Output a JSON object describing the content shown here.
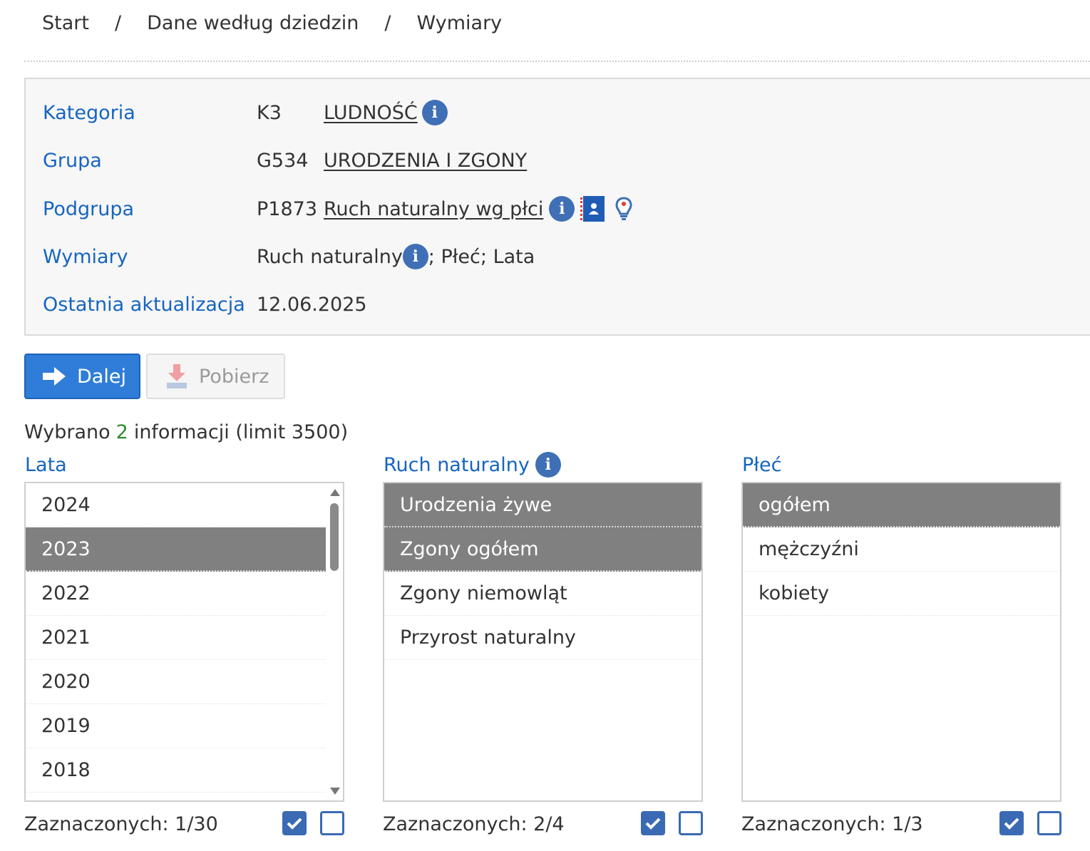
{
  "breadcrumb": {
    "items": [
      "Start",
      "Dane według dziedzin",
      "Wymiary"
    ],
    "separator": "/"
  },
  "info": {
    "kategoria": {
      "label": "Kategoria",
      "code": "K3",
      "value": "LUDNOŚĆ"
    },
    "grupa": {
      "label": "Grupa",
      "code": "G534",
      "value": "URODZENIA I ZGONY"
    },
    "podgrupa": {
      "label": "Podgrupa",
      "code": "P1873",
      "value": "Ruch naturalny wg płci"
    },
    "wymiary": {
      "label": "Wymiary",
      "value_first": "Ruch naturalny",
      "value_rest": "; Płeć; Lata"
    },
    "aktualizacja": {
      "label": "Ostatnia aktualizacja",
      "value": "12.06.2025"
    }
  },
  "buttons": {
    "next_label": "Dalej",
    "download_label": "Pobierz"
  },
  "summary": {
    "prefix": "Wybrano",
    "count": "2",
    "suffix": "informacji (limit 3500)"
  },
  "lists": {
    "lata": {
      "title": "Lata",
      "items": [
        {
          "label": "2024",
          "selected": false
        },
        {
          "label": "2023",
          "selected": true
        },
        {
          "label": "2022",
          "selected": false
        },
        {
          "label": "2021",
          "selected": false
        },
        {
          "label": "2020",
          "selected": false
        },
        {
          "label": "2019",
          "selected": false
        },
        {
          "label": "2018",
          "selected": false
        }
      ],
      "footer": "Zaznaczonych: 1/30"
    },
    "ruch": {
      "title": "Ruch naturalny",
      "items": [
        {
          "label": "Urodzenia żywe",
          "selected": true
        },
        {
          "label": "Zgony ogółem",
          "selected": true
        },
        {
          "label": "Zgony niemowląt",
          "selected": false
        },
        {
          "label": "Przyrost naturalny",
          "selected": false
        }
      ],
      "footer": "Zaznaczonych: 2/4"
    },
    "plec": {
      "title": "Płeć",
      "items": [
        {
          "label": "ogółem",
          "selected": true
        },
        {
          "label": "mężczyźni",
          "selected": false
        },
        {
          "label": "kobiety",
          "selected": false
        }
      ],
      "footer": "Zaznaczonych: 1/3"
    }
  },
  "icons": {
    "info": "info-icon",
    "card": "metadata-card-icon",
    "bulb": "lightbulb-icon",
    "arrow": "arrow-right-icon",
    "download": "download-icon",
    "check_all": "checkbox-checked-icon",
    "check_none": "checkbox-empty-icon"
  },
  "colors": {
    "link_blue": "#1565c0",
    "primary_button": "#2f7dd8",
    "selected_item": "#808080",
    "count_green": "#2e8b2e",
    "checkbox_blue": "#3a6ab3"
  }
}
